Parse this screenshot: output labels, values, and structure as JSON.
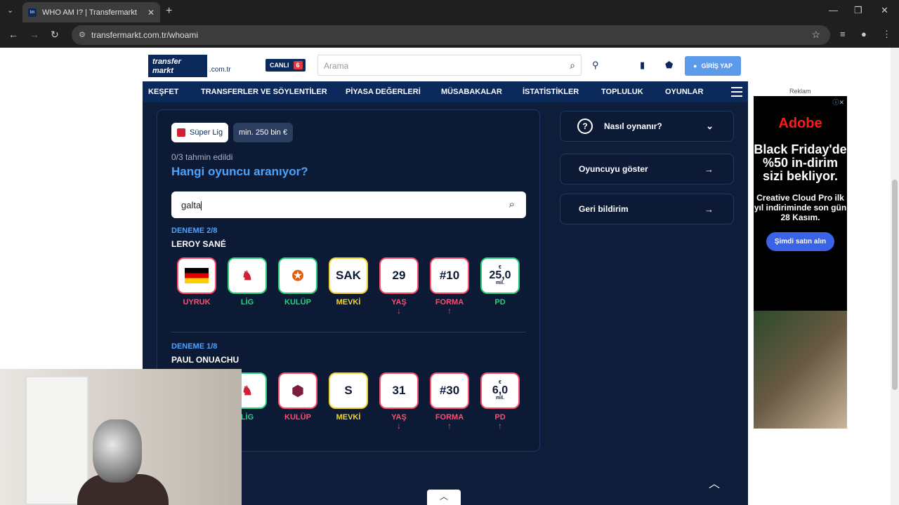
{
  "browser": {
    "tab_title": "WHO AM I? | Transfermarkt",
    "url": "transfermarkt.com.tr/whoami"
  },
  "header": {
    "logo_line1": "transfer",
    "logo_line2": "markt",
    "domain": ".com.tr",
    "live_label": "CANLI",
    "live_count": "6",
    "search_placeholder": "Arama",
    "login_label": "GİRİŞ YAP"
  },
  "nav": [
    "KEŞFET",
    "TRANSFERLER VE SÖYLENTİLER",
    "PİYASA DEĞERLERİ",
    "MÜSABAKALAR",
    "İSTATİSTİKLER",
    "TOPLULUK",
    "OYUNLAR"
  ],
  "game": {
    "chip_league": "Süper Lig",
    "chip_value": "min. 250 bin €",
    "guessed": "0/3 tahmin edildi",
    "question": "Hangi oyuncu aranıyor?",
    "input_value": "galta",
    "attempts": [
      {
        "label": "DENEME 2/8",
        "player": "LEROY SANÉ",
        "tiles": [
          {
            "value": "",
            "caption": "UYRUK",
            "state": "red",
            "icon": "germany-flag"
          },
          {
            "value": "",
            "caption": "LİG",
            "state": "green",
            "icon": "trendyol-superlig-logo"
          },
          {
            "value": "",
            "caption": "KULÜP",
            "state": "green",
            "icon": "galatasaray-logo"
          },
          {
            "value": "SAK",
            "caption": "MEVKİ",
            "state": "yellow"
          },
          {
            "value": "29",
            "caption": "YAŞ",
            "state": "red",
            "arrow": "↓"
          },
          {
            "value": "#10",
            "caption": "FORMA",
            "state": "red",
            "arrow": "↑"
          },
          {
            "value": "25,0",
            "unit_top": "€",
            "unit_bottom": "mil.",
            "caption": "PD",
            "state": "green"
          }
        ]
      },
      {
        "label": "DENEME 1/8",
        "player": "PAUL ONUACHU",
        "tiles": [
          {
            "value": "",
            "caption": "LİG",
            "state": "green",
            "icon": "trendyol-superlig-logo"
          },
          {
            "value": "",
            "caption": "KULÜP",
            "state": "red",
            "icon": "trabzonspor-logo"
          },
          {
            "value": "S",
            "caption": "MEVKİ",
            "state": "yellow"
          },
          {
            "value": "31",
            "caption": "YAŞ",
            "state": "red",
            "arrow": "↓"
          },
          {
            "value": "#30",
            "caption": "FORMA",
            "state": "red",
            "arrow": "↑"
          },
          {
            "value": "6,0",
            "unit_top": "€",
            "unit_bottom": "mil.",
            "caption": "PD",
            "state": "red",
            "arrow": "↑"
          }
        ]
      }
    ]
  },
  "sidebar": {
    "how_to_play": "Nasıl oynanır?",
    "show_player": "Oyuncuyu göster",
    "feedback": "Geri bildirim"
  },
  "ad": {
    "label": "Reklam",
    "brand": "Adobe",
    "headline": "Black Friday'de %50 in-dirim sizi bekliyor.",
    "subtext": "Creative Cloud Pro ilk yıl indiriminde son gün 28 Kasım.",
    "cta": "Şimdi satın alın"
  }
}
